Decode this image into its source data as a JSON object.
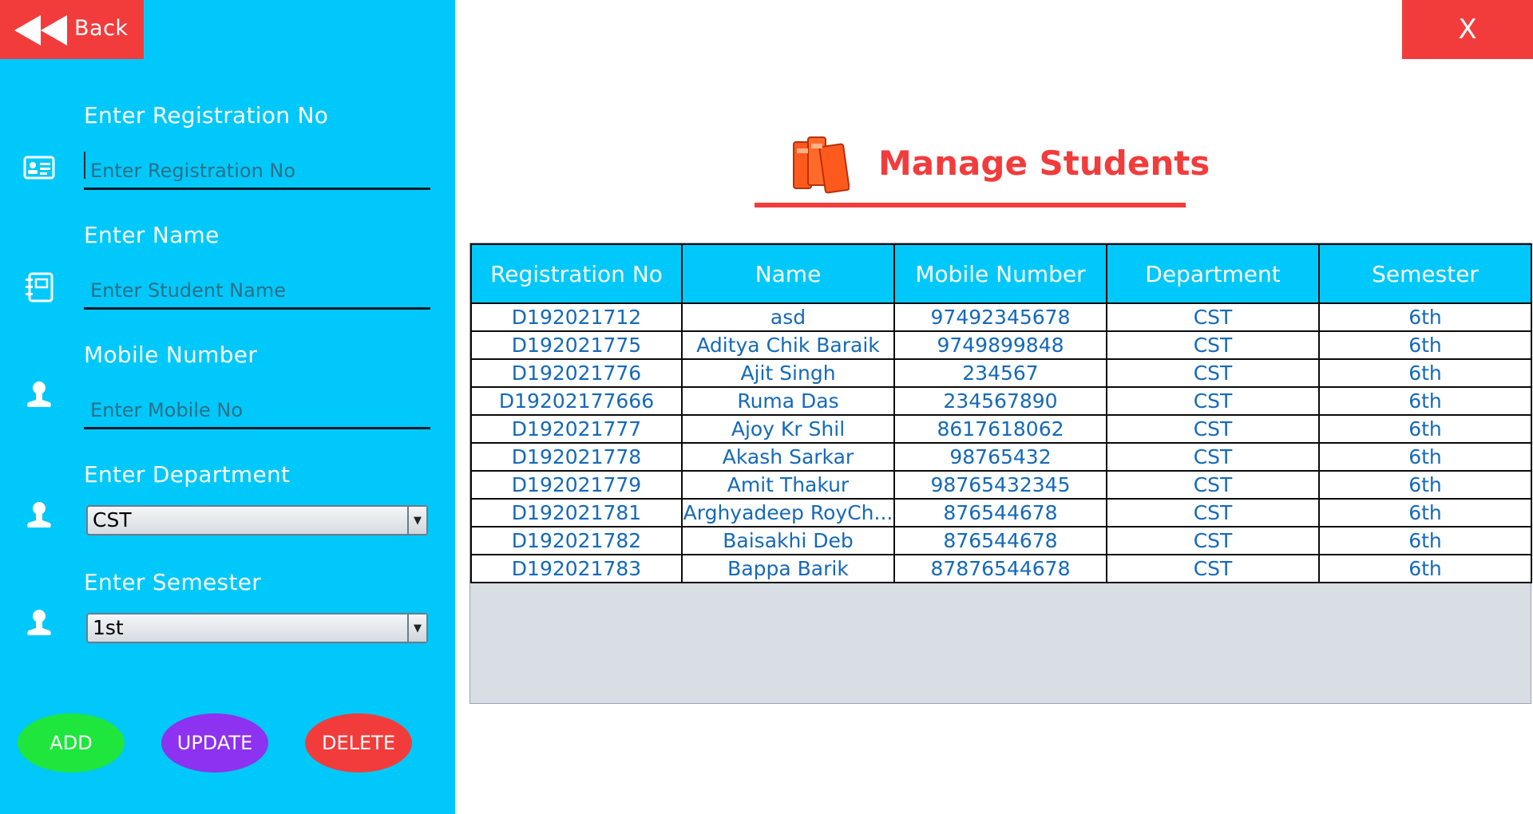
{
  "nav": {
    "back_label": "Back",
    "close_label": "X"
  },
  "form": {
    "registration": {
      "label": "Enter Registration No",
      "placeholder": "Enter Registration No"
    },
    "name": {
      "label": "Enter Name",
      "placeholder": "Enter Student Name"
    },
    "mobile": {
      "label": "Mobile Number",
      "placeholder": "Enter Mobile No"
    },
    "department": {
      "label": "Enter Department",
      "value": "CST"
    },
    "semester": {
      "label": "Enter Semester",
      "value": "1st"
    }
  },
  "actions": {
    "add_label": "ADD",
    "update_label": "UPDATE",
    "delete_label": "DELETE"
  },
  "header": {
    "title": "Manage Students"
  },
  "table": {
    "columns": [
      "Registration No",
      "Name",
      "Mobile Number",
      "Department",
      "Semester"
    ],
    "rows": [
      [
        "D192021712",
        "asd",
        "97492345678",
        "CST",
        "6th"
      ],
      [
        "D192021775",
        "Aditya Chik Baraik",
        "9749899848",
        "CST",
        "6th"
      ],
      [
        "D192021776",
        "Ajit Singh",
        "234567",
        "CST",
        "6th"
      ],
      [
        "D19202177666",
        "Ruma Das",
        "234567890",
        "CST",
        "6th"
      ],
      [
        "D192021777",
        "Ajoy Kr Shil",
        "8617618062",
        "CST",
        "6th"
      ],
      [
        "D192021778",
        "Akash Sarkar",
        "98765432",
        "CST",
        "6th"
      ],
      [
        "D192021779",
        "Amit Thakur",
        "98765432345",
        "CST",
        "6th"
      ],
      [
        "D192021781",
        "Arghyadeep RoyCh...",
        "876544678",
        "CST",
        "6th"
      ],
      [
        "D192021782",
        "Baisakhi Deb",
        "876544678",
        "CST",
        "6th"
      ],
      [
        "D192021783",
        "Bappa Barik",
        "87876544678",
        "CST",
        "6th"
      ]
    ]
  },
  "colors": {
    "sidebar": "#00c8fa",
    "accent_red": "#f23c3c",
    "add": "#1ee63c",
    "update": "#8c32f0",
    "delete": "#f23c3c",
    "cell_text": "#1569b8"
  }
}
